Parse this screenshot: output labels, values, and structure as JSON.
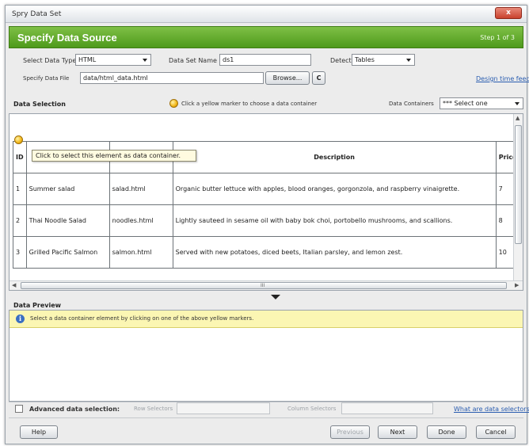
{
  "window": {
    "title": "Spry Data Set",
    "close_glyph": "x"
  },
  "banner": {
    "heading": "Specify Data Source",
    "step": "Step 1 of 3"
  },
  "form": {
    "data_type_label": "Select Data Type",
    "data_type_value": "HTML",
    "data_set_name_label": "Data Set Name",
    "data_set_name_value": "ds1",
    "detect_label": "Detect",
    "detect_value": "Tables",
    "data_file_label": "Specify Data File",
    "data_file_value": "data/html_data.html",
    "browse_label": "Browse...",
    "refresh_glyph": "C",
    "design_link": "Design time feed"
  },
  "data_selection": {
    "heading": "Data Selection",
    "hint": "Click a yellow marker to choose a data container",
    "containers_label": "Data Containers",
    "containers_value": "*** Select one",
    "tooltip": "Click to select this element as data container.",
    "table": {
      "headers": [
        "ID",
        "",
        "",
        "Description",
        "Price"
      ],
      "rows": [
        [
          "1",
          "Summer salad",
          "salad.html",
          "Organic butter lettuce with apples, blood oranges, gorgonzola, and raspberry vinaigrette.",
          "7"
        ],
        [
          "2",
          "Thai Noodle Salad",
          "noodles.html",
          "Lightly sauteed in sesame oil with baby bok choi, portobello mushrooms, and scallions.",
          "8"
        ],
        [
          "3",
          "Grilled Pacific Salmon",
          "salmon.html",
          "Served with new potatoes, diced beets, Italian parsley, and lemon zest.",
          "10"
        ]
      ]
    },
    "scroll_mid_glyph": "III"
  },
  "preview": {
    "heading": "Data Preview",
    "info_text": "Select a data container element by clicking on one of the above yellow markers.",
    "info_glyph": "i"
  },
  "advanced": {
    "label": "Advanced data selection:",
    "row_selectors_label": "Row Selectors",
    "column_selectors_label": "Column Selectors",
    "help_link": "What are data selectors?"
  },
  "footer": {
    "help": "Help",
    "previous": "Previous",
    "next": "Next",
    "done": "Done",
    "cancel": "Cancel"
  },
  "colors": {
    "banner": "#5aa526",
    "info_bar": "#fbf6b3",
    "link": "#2a5db0",
    "marker": "#f2b615"
  }
}
